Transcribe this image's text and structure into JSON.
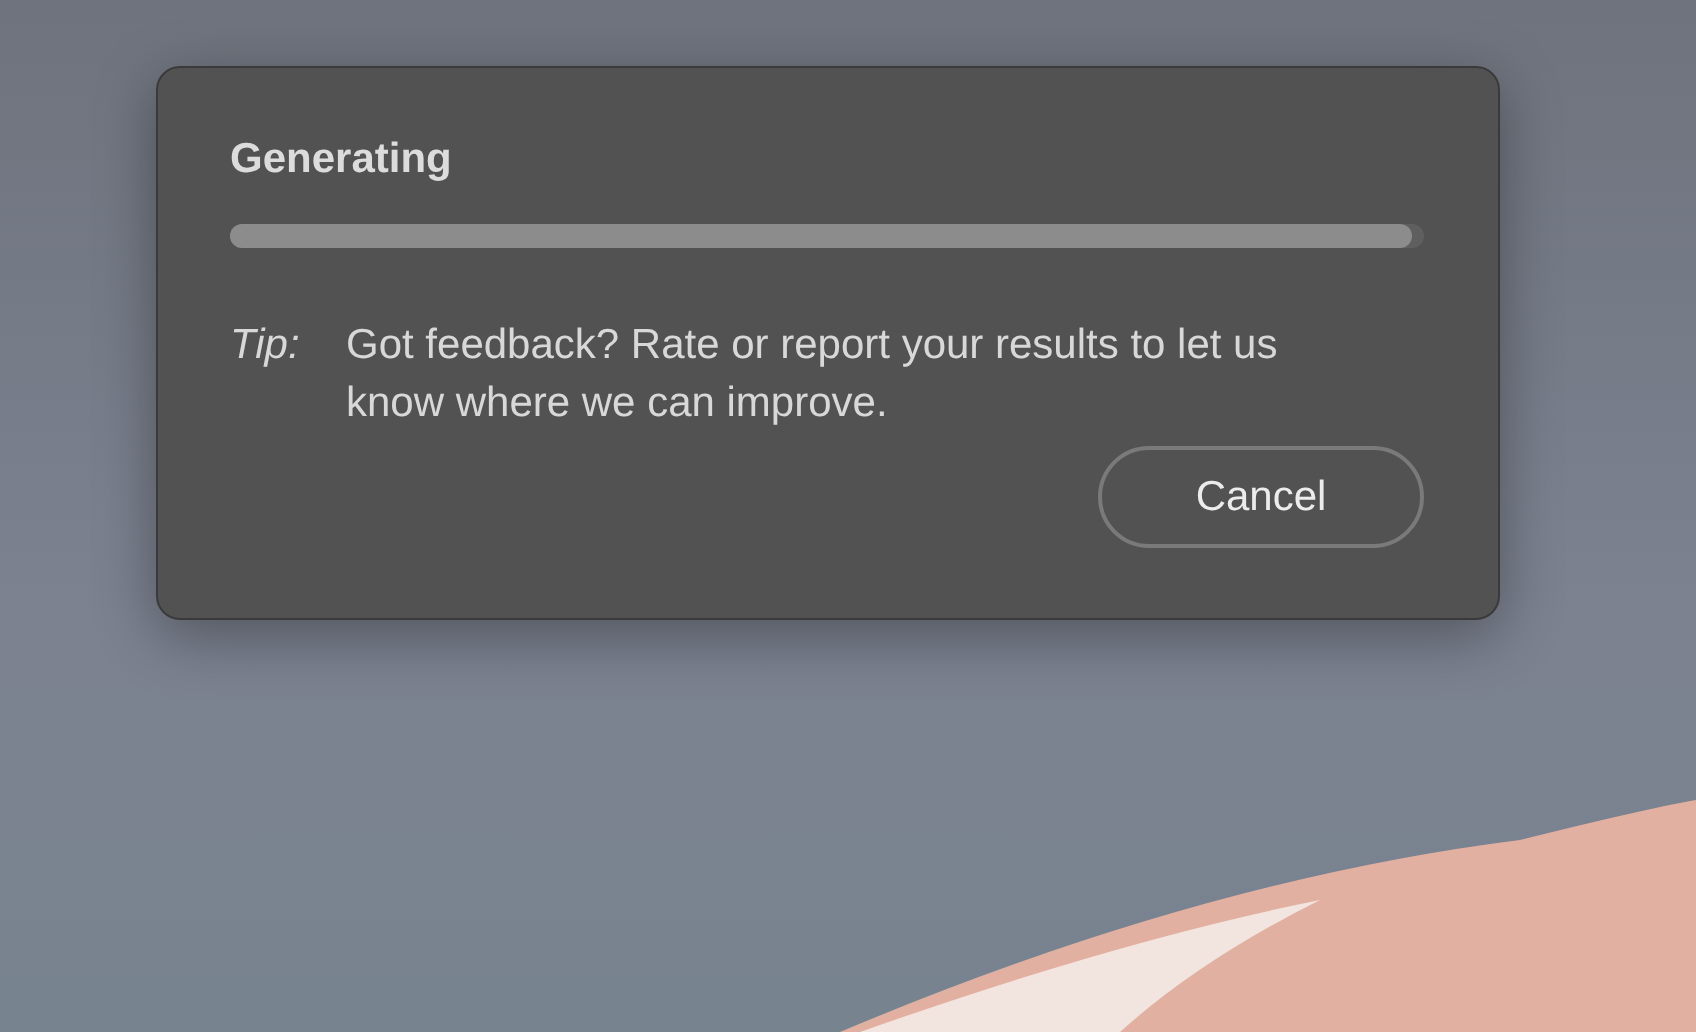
{
  "dialog": {
    "title": "Generating",
    "progress": {
      "level": 0.99
    },
    "tip": {
      "label": "Tip:",
      "text": "Got feedback? Rate or report your results to let us know where we can improve."
    },
    "buttons": [
      {
        "label": "Cancel"
      }
    ]
  }
}
